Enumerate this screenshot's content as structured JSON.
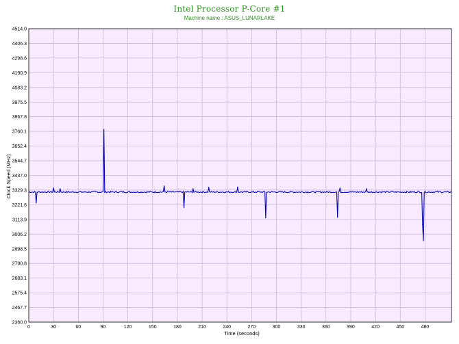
{
  "chart_data": {
    "type": "line",
    "title": "Intel Processor P-Core #1",
    "subtitle": "Machine name : ASUS_LUNARLAKE",
    "xlabel": "Time (seconds)",
    "ylabel": "Clock Speed (MHz)",
    "xlim": [
      0,
      512
    ],
    "ylim": [
      2360.0,
      4514.0
    ],
    "x_ticks": [
      0,
      30,
      60,
      90,
      120,
      150,
      180,
      210,
      240,
      270,
      300,
      330,
      360,
      390,
      420,
      450,
      480
    ],
    "y_ticks": [
      "2360.0",
      "2467.7",
      "2575.4",
      "2683.1",
      "2790.8",
      "2898.5",
      "3006.2",
      "3113.9",
      "3221.6",
      "3329.3",
      "3437.0",
      "3544.7",
      "3652.4",
      "3760.1",
      "3867.8",
      "3975.5",
      "4083.2",
      "4190.9",
      "4298.6",
      "4406.3",
      "4514.0"
    ],
    "grid": true,
    "background_color": "#f8eaff",
    "grid_color": "#cbb8d8",
    "series": [
      {
        "color": "#0000aa",
        "baseline": 3315,
        "spikes": [
          {
            "x": 9,
            "y": 3235
          },
          {
            "x": 30,
            "y": 3345
          },
          {
            "x": 38,
            "y": 3340
          },
          {
            "x": 91,
            "y": 3775
          },
          {
            "x": 164,
            "y": 3360
          },
          {
            "x": 188,
            "y": 3200
          },
          {
            "x": 199,
            "y": 3340
          },
          {
            "x": 218,
            "y": 3350
          },
          {
            "x": 253,
            "y": 3352
          },
          {
            "x": 287,
            "y": 3125
          },
          {
            "x": 374,
            "y": 3130
          },
          {
            "x": 377,
            "y": 3345
          },
          {
            "x": 409,
            "y": 3338
          },
          {
            "x": 477,
            "y": 3075
          },
          {
            "x": 478,
            "y": 2958
          }
        ]
      }
    ]
  }
}
